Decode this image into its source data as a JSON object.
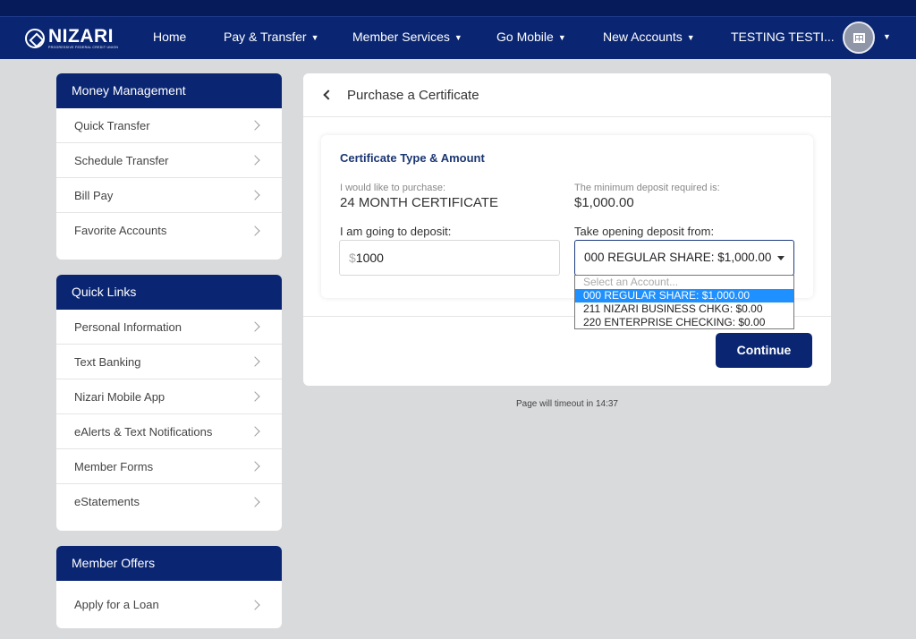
{
  "brand": {
    "logo_text": "NIZARI",
    "logo_subtext": "PROGRESSIVE FEDERAL CREDIT UNION"
  },
  "nav": {
    "items": [
      {
        "label": "Home"
      },
      {
        "label": "Pay & Transfer"
      },
      {
        "label": "Member Services"
      },
      {
        "label": "Go Mobile"
      },
      {
        "label": "New Accounts"
      },
      {
        "label": "TESTING TESTI..."
      }
    ]
  },
  "sidebar": {
    "money_management": {
      "title": "Money Management",
      "items": [
        "Quick Transfer",
        "Schedule Transfer",
        "Bill Pay",
        "Favorite Accounts"
      ]
    },
    "quick_links": {
      "title": "Quick Links",
      "items": [
        "Personal Information",
        "Text Banking",
        "Nizari Mobile App",
        "eAlerts & Text Notifications",
        "Member Forms",
        "eStatements"
      ]
    },
    "member_offers": {
      "title": "Member Offers",
      "items": [
        "Apply for a Loan"
      ]
    }
  },
  "main": {
    "title": "Purchase a Certificate",
    "section_title": "Certificate Type & Amount",
    "purchase_label": "I would like to purchase:",
    "purchase_value": "24 MONTH CERTIFICATE",
    "minimum_label": "The minimum deposit required is:",
    "minimum_value": "$1,000.00",
    "deposit_label": "I am going to deposit:",
    "currency_symbol": "$",
    "deposit_value": "1000",
    "source_label": "Take opening deposit from:",
    "source_selected": "000 REGULAR SHARE: $1,000.00",
    "source_options": [
      "Select an Account...",
      "000 REGULAR SHARE: $1,000.00",
      "211 NIZARI BUSINESS CHKG: $0.00",
      "220 ENTERPRISE CHECKING: $0.00"
    ],
    "continue_label": "Continue"
  },
  "timeout_text": "Page will timeout in 14:37",
  "colors": {
    "brand_navy": "#0a2672",
    "top_strip": "#061b59",
    "option_highlight": "#1e90ff",
    "page_bg": "#d9dadc"
  }
}
